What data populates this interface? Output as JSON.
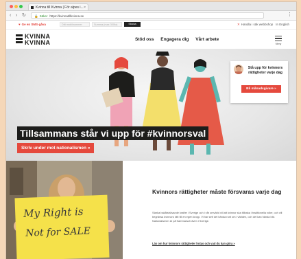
{
  "browser": {
    "tab_title": "Kvinna till Kvinna | För alpes i...",
    "url_secure": "Säker",
    "url": "https://kvinnatillkvinna.se"
  },
  "utility": {
    "donate": "Ge en SMS-gåva",
    "field1_placeholder": "Ditt mobilnummer",
    "field2_placeholder": "Summa (max 300kr)",
    "submit": "Skicka",
    "hide_site": "Handla i säk webbshop",
    "language": "In English"
  },
  "logo": {
    "line1": "KVINNA",
    "line2": "KVINNA"
  },
  "nav": [
    "Stöd oss",
    "Engagera dig",
    "Vårt arbete"
  ],
  "menu_label": "Meny",
  "hero": {
    "title": "Tillsammans står vi upp för #kvinnorsval",
    "cta": "Skriv under mot nationalismen »"
  },
  "card": {
    "text": "Stå upp för kvinnors rättigheter varje dag",
    "button": "Bli månadsgivare »"
  },
  "article": {
    "sign_line1": "My Right is",
    "sign_line2": "Not for SALE",
    "title": "Kvinnors rättigheter måste försvaras varje dag",
    "body": "Starka bakåtsträvande krafter i Sverige och i vår omvärld vill att kvinnor ska tillbaka i traditionella roller, och vill begränsa kvinnors rätt till en egen kropp. Vi har sett det hända runt om i världen, och det kan hända här. Nationalismen är på frammarsch även i Sverige.",
    "link": "Läs om hur kvinnors rättigheter hotas och vad du kan göra »"
  },
  "colors": {
    "accent": "#e5493d",
    "dark": "#1d1d1b",
    "yellow": "#f5e14a"
  }
}
